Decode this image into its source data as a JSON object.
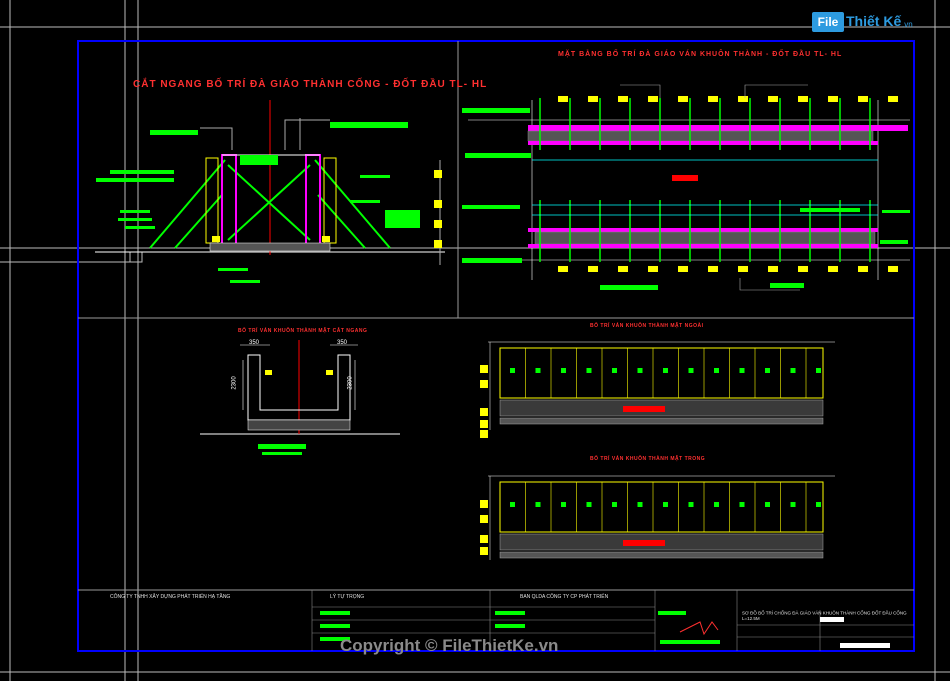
{
  "logo": {
    "part1": "File",
    "part2": "Thiết Kế",
    "part3": ".vn"
  },
  "copyright": "Copyright © FileThietKe.vn",
  "titles": {
    "section_elevation": "CẮT NGANG BỐ TRÍ ĐÀ GIÁO THÀNH CỐNG - ĐỐT ĐẦU TL- HL",
    "plan_layout": "MẶT BẰNG BỐ TRÍ ĐÀ GIÁO VÁN KHUÔN THÀNH - ĐỐT ĐẦU TL- HL",
    "formwork_section": "BỐ TRÍ VÁN KHUÔN THÀNH MẶT CẮT NGANG",
    "formwork_outer": "BỐ TRÍ VÁN KHUÔN THÀNH MẶT NGOÀI",
    "formwork_inner": "BỐ TRÍ VÁN KHUÔN THÀNH MẶT TRONG"
  },
  "dimensions": {
    "d350_left": "350",
    "d350_right": "350",
    "d2300_left": "2300",
    "d2300_right": "2300"
  },
  "title_block": {
    "owner": "CÔNG TY TNHH XÂY DỰNG PHÁT TRIỂN HẠ TẦNG",
    "project": "LÝ TỰ TRỌNG",
    "contractor": "BAN QLDA CÔNG TY CP PHÁT TRIỂN",
    "drawing_title": "SƠ ĐỒ BỐ TRÍ CHỐNG ĐÀ GIÁO VÁN KHUÔN THÀNH CỐNG ĐỐT ĐẦU CỐNG L=12.5M"
  },
  "colors": {
    "border": "#0000ff",
    "frame": "#ffffff",
    "green": "#00ff00",
    "yellow": "#ffff00",
    "red": "#ff0000",
    "magenta": "#ff00ff",
    "cyan": "#00ffff",
    "grey": "#909090"
  }
}
